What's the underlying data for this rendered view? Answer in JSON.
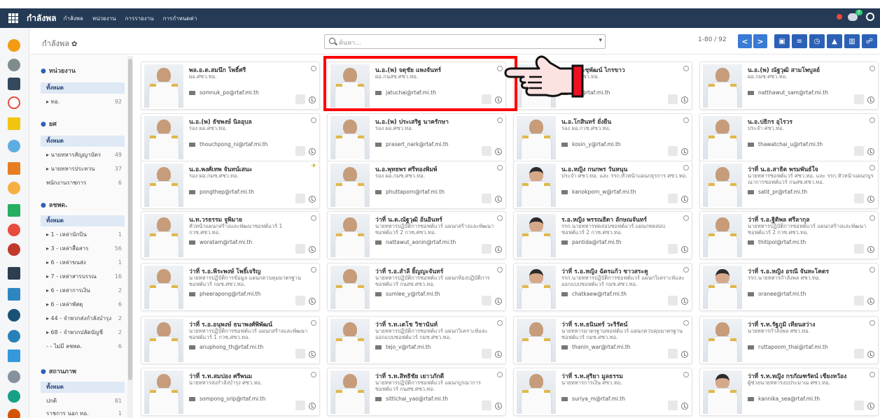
{
  "app": {
    "title": "กำลังพล",
    "menu": [
      "กำลังพล",
      "หน่วยงาน",
      "การรายงาน",
      "การกำหนดค่า"
    ],
    "badge": "7"
  },
  "control": {
    "breadcrumb": "กำลังพล",
    "search_placeholder": "ค้นหา...",
    "pager": "1-80 / 92",
    "prev": "<",
    "next": ">"
  },
  "sidebar": {
    "sections": [
      {
        "title": "หน่วยงาน",
        "items": [
          {
            "label": "ทั้งหมด",
            "count": ""
          },
          {
            "label": "▸ ทอ.",
            "count": "92"
          }
        ]
      },
      {
        "title": "ยศ",
        "items": [
          {
            "label": "ทั้งหมด",
            "count": ""
          },
          {
            "label": "▸ นายทหารสัญญาบัตร",
            "count": "49"
          },
          {
            "label": "▸ นายทหารประทวน",
            "count": "37"
          },
          {
            "label": "พนักงานราชการ",
            "count": "6"
          }
        ]
      },
      {
        "title": "ลชพด.",
        "items": [
          {
            "label": "ทั้งหมด",
            "count": ""
          },
          {
            "label": "▸ 1 - เหล่านักบิน",
            "count": "1"
          },
          {
            "label": "▸ 3 - เหล่าสื่อสาร",
            "count": "56"
          },
          {
            "label": "▸ 6 - เหล่าขนส่ง",
            "count": "1"
          },
          {
            "label": "▸ 7 - เหล่าสารบรรณ",
            "count": "16"
          },
          {
            "label": "▸ 6 - เหล่าการเงิน",
            "count": "2"
          },
          {
            "label": "▸ 6 - เหล่าพัสดุ",
            "count": "6"
          },
          {
            "label": "▸ 44 - จำพวกส่งกำลังบำรุง",
            "count": "2"
          },
          {
            "label": "▸ 68 - จำพวกปลัดบัญชี",
            "count": "2"
          },
          {
            "label": "- - ไม่มี ลชพด.",
            "count": "6"
          }
        ]
      },
      {
        "title": "สถานภาพ",
        "items": [
          {
            "label": "ทั้งหมด",
            "count": ""
          },
          {
            "label": "ปกติ",
            "count": "81"
          },
          {
            "label": "ราชการ นอก ทอ.",
            "count": "1"
          }
        ]
      }
    ]
  },
  "cards": [
    {
      "name": "พล.อ.ต.สมนึก โพธิ์ศรี",
      "job": "ผอ.ศซว.ทอ.",
      "email": "somnuk_po@rtaf.mi.th",
      "f": false
    },
    {
      "name": "น.อ.(พ) จตุชัย แพงจันทร์",
      "job": "ผอ.กนสซ.ศซว.ทอ.",
      "email": "jatuchai@rtaf.mi.th",
      "f": false
    },
    {
      "name": "น.อ.ชนะชุพัฒน์ ไกรขาว",
      "job": "รอง ผอ.ศซว.ทอ.",
      "email": "ger@rtaf.mi.th",
      "f": false
    },
    {
      "name": "น.อ.(พ) ณัฐวุฒิ สามโพบูลย์",
      "job": "ผอ.กมซ.ศซว.ทอ.",
      "email": "natthawut_sam@rtaf.mi.th",
      "f": false
    },
    {
      "name": "น.อ.(พ) ธัชพงษ์ นิลอุบล",
      "job": "รอง ผอ.ศซว.ทอ.",
      "email": "thouchpong_ni@rtaf.mi.th",
      "f": false
    },
    {
      "name": "น.อ.(พ) ประเสริฐ นาครักษา",
      "job": "รอง ผอ.ศซว.ทอ.",
      "email": "prasert_nark@rtaf.mi.th",
      "f": false
    },
    {
      "name": "น.อ.โกสินทร์ ยั่งยืน",
      "job": "รอง ผอ.กวซ.ศซว.ทอ.",
      "email": "kosin_y@rtaf.mi.th",
      "f": false
    },
    {
      "name": "น.อ.ปธิกร อุไรวร",
      "job": "ประจำ ศซว.ทอ.",
      "email": "thawatchai_u@rtaf.mi.th",
      "f": false
    },
    {
      "name": "น.อ.พงศ์เทพ จันทน์เสนะ",
      "job": "รอง ผอ.กมซ.ศซว.ทอ.",
      "email": "pongthep@rtaf.mi.th",
      "f": false,
      "star": true
    },
    {
      "name": "น.อ.พุทธพร ศรีทองพิมพ์",
      "job": "รอง ผอ.กมซ.ศซว.ทอ.",
      "email": "phuttaporn@rtaf.mi.th",
      "f": false
    },
    {
      "name": "น.อ.หญิง กนกพร วันหนุน",
      "job": "ประจำ ศซว.ทอ. และ รรก.หัวหน้าแผนกธุรการ ศซว.ทอ.",
      "email": "kanokporn_w@rtaf.mi.th",
      "f": true
    },
    {
      "name": "ว่าที่ น.อ.สาธิต พรมพันธ์ใจ",
      "job": "นายทหารซอฟต์แวร์ ศซว.ทอ. และ รรก.หัวหน้าแผนกบูรณาการซอฟต์แวร์ กนสซ.ศซว.ทอ.",
      "email": "satit_pr@rtaf.mi.th",
      "f": false
    },
    {
      "name": "น.ท.วรธรรม จูพิมาย",
      "job": "หัวหน้าแผนกสร้างและพัฒนาซอฟต์แวร์ 1 กวซ.ศซว.ทอ.",
      "email": "woratam@rtaf.mi.th",
      "f": false
    },
    {
      "name": "ว่าที่ น.ต.ณัฐวุฒิ อ้นอินทร์",
      "job": "นายทหารปฏิบัติการซอฟต์แวร์ แผนกสร้างและพัฒนาซอฟต์แวร์ 2 กวซ.ศซว.ทอ.",
      "email": "nattawut_aonin@rtaf.mi.th",
      "f": false
    },
    {
      "name": "ร.อ.หญิง พรรณธิดา ลักษณจันทร์",
      "job": "รรก.นายทหารทดสอบซอฟต์แวร์ แผนกทดสอบซอฟต์แวร์ 2 กวซ.ศซว.ทอ.",
      "email": "pantida@rtaf.mi.th",
      "f": true
    },
    {
      "name": "ว่าที่ ร.อ.ฐิติพล ศรีลากุล",
      "job": "นายทหารปฏิบัติการซอฟต์แวร์ แผนกสร้างและพัฒนาซอฟต์แวร์ 2 กวซ.ศซว.ทอ.",
      "email": "thitipol@rtaf.mi.th",
      "f": false
    },
    {
      "name": "ว่าที่ ร.อ.พีระพงษ์ โพธิ์เจริญ",
      "job": "นายทหารปฏิบัติการข้อมูล แผนกควบคุมมาตรฐานซอฟต์แวร์ กมซ.ศซว.ทอ.",
      "email": "pheerapong@rtaf.mi.th",
      "f": false
    },
    {
      "name": "ว่าที่ ร.อ.สำลี ยิ้ญญะจันทร์",
      "job": "นายทหารปฏิบัติการซอฟต์แวร์ แผนกห้องปฏิบัติการซอฟต์แวร์ กนสซ.ศซว.ทอ.",
      "email": "sumlee_y@rtaf.mi.th",
      "f": false
    },
    {
      "name": "ว่าที่ ร.อ.หญิง ฉัตรแก้ว ชาวสระคู",
      "job": "รรก.นายทหารปฏิบัติการซอฟต์แวร์ แผนกวิเคราะห์และออกแบบซอฟต์แวร์ กมซ.ศซว.ทอ.",
      "email": "chatkaew@rtaf.mi.th",
      "f": true
    },
    {
      "name": "ว่าที่ ร.อ.หญิง อรณี จันทะโคตร",
      "job": "รรก.นายทหารกำลังพล ศซว.ทอ.",
      "email": "oranee@rtaf.mi.th",
      "f": true
    },
    {
      "name": "ว่าที่ ร.อ.อนุพงษ์ ธนาพงศ์พิพัฒน์",
      "job": "นายทหารปฏิบัติการซอฟต์แวร์ แผนกสร้างและพัฒนาซอฟต์แวร์ 1 กวซ.ศซว.ทอ.",
      "email": "anuphong_th@rtaf.mi.th",
      "f": false
    },
    {
      "name": "ว่าที่ ร.ท.เตโช วิชานันท์",
      "job": "นายทหารปฏิบัติการซอฟต์แวร์ แผนกวิเคราะห์และออกแบบซอฟต์แวร์ กมซ.ศซว.ทอ.",
      "email": "tejo_v@rtaf.mi.th",
      "f": false
    },
    {
      "name": "ว่าที่ ร.ท.ธนินทร์ วะริรัตน์",
      "job": "นายทหารมาตรฐานซอฟต์แวร์ แผนกควบคุมมาตรฐานซอฟต์แวร์ กมซ.ศซว.ทอ.",
      "email": "thanin_war@rtaf.mi.th",
      "f": false
    },
    {
      "name": "ว่าที่ ร.ท.รัฐภูมิ เทียนสว่าง",
      "job": "นายทหารกำลังพล ศซว.ทอ.",
      "email": "ruttapoom_thai@rtaf.mi.th",
      "f": false
    },
    {
      "name": "ว่าที่ ร.ท.สมปอง ศรีพนม",
      "job": "นายทหารส่งกำลังบำรุง ศซว.ทอ.",
      "email": "sompong_srip@rtaf.mi.th",
      "f": false
    },
    {
      "name": "ว่าที่ ร.ท.สิทธิชัย เยาวภักดี",
      "job": "นายทหารปฏิบัติการซอฟต์แวร์ แผนกบูรณาการซอฟต์แวร์ กนสซ.ศซว.ทอ.",
      "email": "sittichai_yao@rtaf.mi.th",
      "f": false
    },
    {
      "name": "ว่าที่ ร.ท.สุริยา มูลธรรม",
      "job": "นายทหารการเงิน ศซว.ทอ.",
      "email": "suriya_m@rtaf.mi.th",
      "f": false
    },
    {
      "name": "ว่าที่ ร.ท.หญิง กรภัณฑรัตน์ เชียงหว้อง",
      "job": "ผู้ช่วยนายทหารงบประมาณ ศซว.ทอ.",
      "email": "kannika_sea@rtaf.mi.th",
      "f": true
    }
  ]
}
